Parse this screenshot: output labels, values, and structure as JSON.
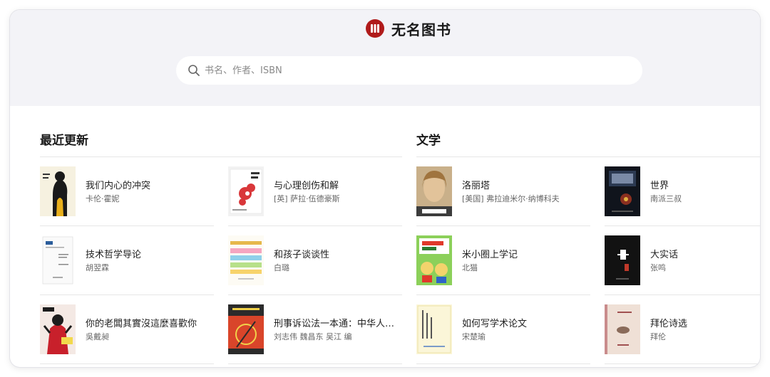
{
  "app": {
    "name": "无名图书"
  },
  "search": {
    "placeholder": "书名、作者、ISBN",
    "value": ""
  },
  "sections": [
    {
      "title": "最近更新",
      "books": [
        {
          "title": "我们内心的冲突",
          "author": "卡伦·霍妮"
        },
        {
          "title": "与心理创伤和解",
          "author": "[英] 萨拉·伍德豪斯"
        },
        {
          "title": "技术哲学导论",
          "author": "胡翌霖"
        },
        {
          "title": "和孩子谈谈性",
          "author": "白璐"
        },
        {
          "title": "你的老闆其實沒這麼喜歡你",
          "author": "吳戴昶"
        },
        {
          "title": "刑事诉讼法一本通：中华人民共和国刑事诉讼法总成",
          "author": "刘志伟 魏昌东 吴江 编"
        }
      ]
    },
    {
      "title": "文学",
      "books": [
        {
          "title": "洛丽塔",
          "author": "[美国] 弗拉迪米尔·纳博科夫"
        },
        {
          "title": "世界",
          "author": "南派三叔"
        },
        {
          "title": "米小圈上学记",
          "author": "北猫"
        },
        {
          "title": "大实话",
          "author": "张鸣"
        },
        {
          "title": "如何写学术论文",
          "author": "宋楚瑜"
        },
        {
          "title": "拜伦诗选",
          "author": "拜伦"
        }
      ]
    }
  ],
  "colors": {
    "brand": "#b01b1b",
    "header_bg": "#f3f3f7",
    "divider": "#e6e6e6"
  },
  "icons": {
    "logo": "book-stack-logo-icon",
    "search": "search-icon"
  }
}
